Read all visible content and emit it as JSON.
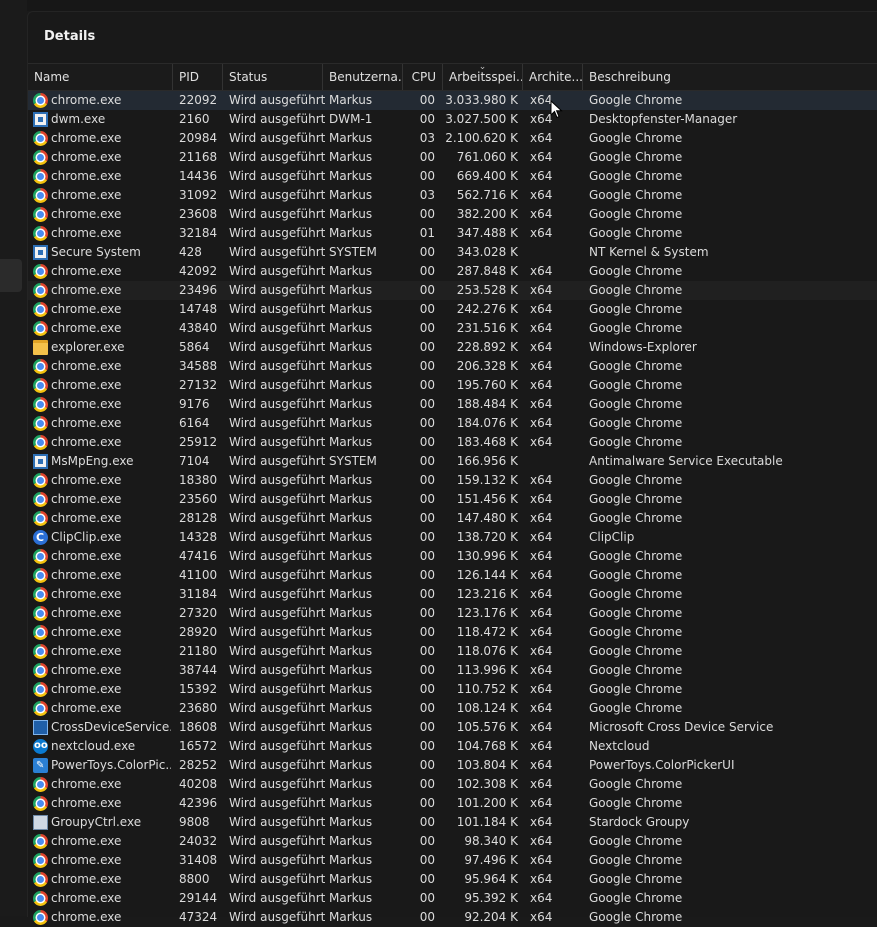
{
  "panel": {
    "title": "Details"
  },
  "columns": {
    "name": "Name",
    "pid": "PID",
    "status": "Status",
    "user": "Benutzerna...",
    "cpu": "CPU",
    "mem": "Arbeitsspei...",
    "arch": "Archite...",
    "desc": "Beschreibung"
  },
  "rows": [
    {
      "name": "chrome.exe",
      "icon": "chrome-icon",
      "pid": "22092",
      "status": "Wird ausgeführt",
      "user": "Markus",
      "cpu": "00",
      "mem": "3.033.980 K",
      "arch": "x64",
      "desc": "Google Chrome"
    },
    {
      "name": "dwm.exe",
      "icon": "system-app-icon",
      "pid": "2160",
      "status": "Wird ausgeführt",
      "user": "DWM-1",
      "cpu": "00",
      "mem": "3.027.500 K",
      "arch": "x64",
      "desc": "Desktopfenster-Manager"
    },
    {
      "name": "chrome.exe",
      "icon": "chrome-icon",
      "pid": "20984",
      "status": "Wird ausgeführt",
      "user": "Markus",
      "cpu": "03",
      "mem": "2.100.620 K",
      "arch": "x64",
      "desc": "Google Chrome"
    },
    {
      "name": "chrome.exe",
      "icon": "chrome-icon",
      "pid": "21168",
      "status": "Wird ausgeführt",
      "user": "Markus",
      "cpu": "00",
      "mem": "761.060 K",
      "arch": "x64",
      "desc": "Google Chrome"
    },
    {
      "name": "chrome.exe",
      "icon": "chrome-icon",
      "pid": "14436",
      "status": "Wird ausgeführt",
      "user": "Markus",
      "cpu": "00",
      "mem": "669.400 K",
      "arch": "x64",
      "desc": "Google Chrome"
    },
    {
      "name": "chrome.exe",
      "icon": "chrome-icon",
      "pid": "31092",
      "status": "Wird ausgeführt",
      "user": "Markus",
      "cpu": "03",
      "mem": "562.716 K",
      "arch": "x64",
      "desc": "Google Chrome"
    },
    {
      "name": "chrome.exe",
      "icon": "chrome-icon",
      "pid": "23608",
      "status": "Wird ausgeführt",
      "user": "Markus",
      "cpu": "00",
      "mem": "382.200 K",
      "arch": "x64",
      "desc": "Google Chrome"
    },
    {
      "name": "chrome.exe",
      "icon": "chrome-icon",
      "pid": "32184",
      "status": "Wird ausgeführt",
      "user": "Markus",
      "cpu": "01",
      "mem": "347.488 K",
      "arch": "x64",
      "desc": "Google Chrome"
    },
    {
      "name": "Secure System",
      "icon": "system-app-icon",
      "pid": "428",
      "status": "Wird ausgeführt",
      "user": "SYSTEM",
      "cpu": "00",
      "mem": "343.028 K",
      "arch": "",
      "desc": "NT Kernel & System"
    },
    {
      "name": "chrome.exe",
      "icon": "chrome-icon",
      "pid": "42092",
      "status": "Wird ausgeführt",
      "user": "Markus",
      "cpu": "00",
      "mem": "287.848 K",
      "arch": "x64",
      "desc": "Google Chrome"
    },
    {
      "name": "chrome.exe",
      "icon": "chrome-icon",
      "pid": "23496",
      "status": "Wird ausgeführt",
      "user": "Markus",
      "cpu": "00",
      "mem": "253.528 K",
      "arch": "x64",
      "desc": "Google Chrome"
    },
    {
      "name": "chrome.exe",
      "icon": "chrome-icon",
      "pid": "14748",
      "status": "Wird ausgeführt",
      "user": "Markus",
      "cpu": "00",
      "mem": "242.276 K",
      "arch": "x64",
      "desc": "Google Chrome"
    },
    {
      "name": "chrome.exe",
      "icon": "chrome-icon",
      "pid": "43840",
      "status": "Wird ausgeführt",
      "user": "Markus",
      "cpu": "00",
      "mem": "231.516 K",
      "arch": "x64",
      "desc": "Google Chrome"
    },
    {
      "name": "explorer.exe",
      "icon": "folder-icon",
      "pid": "5864",
      "status": "Wird ausgeführt",
      "user": "Markus",
      "cpu": "00",
      "mem": "228.892 K",
      "arch": "x64",
      "desc": "Windows-Explorer"
    },
    {
      "name": "chrome.exe",
      "icon": "chrome-icon",
      "pid": "34588",
      "status": "Wird ausgeführt",
      "user": "Markus",
      "cpu": "00",
      "mem": "206.328 K",
      "arch": "x64",
      "desc": "Google Chrome"
    },
    {
      "name": "chrome.exe",
      "icon": "chrome-icon",
      "pid": "27132",
      "status": "Wird ausgeführt",
      "user": "Markus",
      "cpu": "00",
      "mem": "195.760 K",
      "arch": "x64",
      "desc": "Google Chrome"
    },
    {
      "name": "chrome.exe",
      "icon": "chrome-icon",
      "pid": "9176",
      "status": "Wird ausgeführt",
      "user": "Markus",
      "cpu": "00",
      "mem": "188.484 K",
      "arch": "x64",
      "desc": "Google Chrome"
    },
    {
      "name": "chrome.exe",
      "icon": "chrome-icon",
      "pid": "6164",
      "status": "Wird ausgeführt",
      "user": "Markus",
      "cpu": "00",
      "mem": "184.076 K",
      "arch": "x64",
      "desc": "Google Chrome"
    },
    {
      "name": "chrome.exe",
      "icon": "chrome-icon",
      "pid": "25912",
      "status": "Wird ausgeführt",
      "user": "Markus",
      "cpu": "00",
      "mem": "183.468 K",
      "arch": "x64",
      "desc": "Google Chrome"
    },
    {
      "name": "MsMpEng.exe",
      "icon": "system-app-icon",
      "pid": "7104",
      "status": "Wird ausgeführt",
      "user": "SYSTEM",
      "cpu": "00",
      "mem": "166.956 K",
      "arch": "",
      "desc": "Antimalware Service Executable"
    },
    {
      "name": "chrome.exe",
      "icon": "chrome-icon",
      "pid": "18380",
      "status": "Wird ausgeführt",
      "user": "Markus",
      "cpu": "00",
      "mem": "159.132 K",
      "arch": "x64",
      "desc": "Google Chrome"
    },
    {
      "name": "chrome.exe",
      "icon": "chrome-icon",
      "pid": "23560",
      "status": "Wird ausgeführt",
      "user": "Markus",
      "cpu": "00",
      "mem": "151.456 K",
      "arch": "x64",
      "desc": "Google Chrome"
    },
    {
      "name": "chrome.exe",
      "icon": "chrome-icon",
      "pid": "28128",
      "status": "Wird ausgeführt",
      "user": "Markus",
      "cpu": "00",
      "mem": "147.480 K",
      "arch": "x64",
      "desc": "Google Chrome"
    },
    {
      "name": "ClipClip.exe",
      "icon": "clipclip-icon",
      "pid": "14328",
      "status": "Wird ausgeführt",
      "user": "Markus",
      "cpu": "00",
      "mem": "138.720 K",
      "arch": "x64",
      "desc": "ClipClip"
    },
    {
      "name": "chrome.exe",
      "icon": "chrome-icon",
      "pid": "47416",
      "status": "Wird ausgeführt",
      "user": "Markus",
      "cpu": "00",
      "mem": "130.996 K",
      "arch": "x64",
      "desc": "Google Chrome"
    },
    {
      "name": "chrome.exe",
      "icon": "chrome-icon",
      "pid": "41100",
      "status": "Wird ausgeführt",
      "user": "Markus",
      "cpu": "00",
      "mem": "126.144 K",
      "arch": "x64",
      "desc": "Google Chrome"
    },
    {
      "name": "chrome.exe",
      "icon": "chrome-icon",
      "pid": "31184",
      "status": "Wird ausgeführt",
      "user": "Markus",
      "cpu": "00",
      "mem": "123.216 K",
      "arch": "x64",
      "desc": "Google Chrome"
    },
    {
      "name": "chrome.exe",
      "icon": "chrome-icon",
      "pid": "27320",
      "status": "Wird ausgeführt",
      "user": "Markus",
      "cpu": "00",
      "mem": "123.176 K",
      "arch": "x64",
      "desc": "Google Chrome"
    },
    {
      "name": "chrome.exe",
      "icon": "chrome-icon",
      "pid": "28920",
      "status": "Wird ausgeführt",
      "user": "Markus",
      "cpu": "00",
      "mem": "118.472 K",
      "arch": "x64",
      "desc": "Google Chrome"
    },
    {
      "name": "chrome.exe",
      "icon": "chrome-icon",
      "pid": "21180",
      "status": "Wird ausgeführt",
      "user": "Markus",
      "cpu": "00",
      "mem": "118.076 K",
      "arch": "x64",
      "desc": "Google Chrome"
    },
    {
      "name": "chrome.exe",
      "icon": "chrome-icon",
      "pid": "38744",
      "status": "Wird ausgeführt",
      "user": "Markus",
      "cpu": "00",
      "mem": "113.996 K",
      "arch": "x64",
      "desc": "Google Chrome"
    },
    {
      "name": "chrome.exe",
      "icon": "chrome-icon",
      "pid": "15392",
      "status": "Wird ausgeführt",
      "user": "Markus",
      "cpu": "00",
      "mem": "110.752 K",
      "arch": "x64",
      "desc": "Google Chrome"
    },
    {
      "name": "chrome.exe",
      "icon": "chrome-icon",
      "pid": "23680",
      "status": "Wird ausgeführt",
      "user": "Markus",
      "cpu": "00",
      "mem": "108.124 K",
      "arch": "x64",
      "desc": "Google Chrome"
    },
    {
      "name": "CrossDeviceService.e...",
      "icon": "cross-device-icon",
      "pid": "18608",
      "status": "Wird ausgeführt",
      "user": "Markus",
      "cpu": "00",
      "mem": "105.576 K",
      "arch": "x64",
      "desc": "Microsoft Cross Device Service"
    },
    {
      "name": "nextcloud.exe",
      "icon": "nextcloud-icon",
      "pid": "16572",
      "status": "Wird ausgeführt",
      "user": "Markus",
      "cpu": "00",
      "mem": "104.768 K",
      "arch": "x64",
      "desc": "Nextcloud"
    },
    {
      "name": "PowerToys.ColorPic...",
      "icon": "color-picker-icon",
      "pid": "28252",
      "status": "Wird ausgeführt",
      "user": "Markus",
      "cpu": "00",
      "mem": "103.804 K",
      "arch": "x64",
      "desc": "PowerToys.ColorPickerUI"
    },
    {
      "name": "chrome.exe",
      "icon": "chrome-icon",
      "pid": "40208",
      "status": "Wird ausgeführt",
      "user": "Markus",
      "cpu": "00",
      "mem": "102.308 K",
      "arch": "x64",
      "desc": "Google Chrome"
    },
    {
      "name": "chrome.exe",
      "icon": "chrome-icon",
      "pid": "42396",
      "status": "Wird ausgeführt",
      "user": "Markus",
      "cpu": "00",
      "mem": "101.200 K",
      "arch": "x64",
      "desc": "Google Chrome"
    },
    {
      "name": "GroupyCtrl.exe",
      "icon": "groupy-icon",
      "pid": "9808",
      "status": "Wird ausgeführt",
      "user": "Markus",
      "cpu": "00",
      "mem": "101.184 K",
      "arch": "x64",
      "desc": "Stardock Groupy"
    },
    {
      "name": "chrome.exe",
      "icon": "chrome-icon",
      "pid": "24032",
      "status": "Wird ausgeführt",
      "user": "Markus",
      "cpu": "00",
      "mem": "98.340 K",
      "arch": "x64",
      "desc": "Google Chrome"
    },
    {
      "name": "chrome.exe",
      "icon": "chrome-icon",
      "pid": "31408",
      "status": "Wird ausgeführt",
      "user": "Markus",
      "cpu": "00",
      "mem": "97.496 K",
      "arch": "x64",
      "desc": "Google Chrome"
    },
    {
      "name": "chrome.exe",
      "icon": "chrome-icon",
      "pid": "8800",
      "status": "Wird ausgeführt",
      "user": "Markus",
      "cpu": "00",
      "mem": "95.964 K",
      "arch": "x64",
      "desc": "Google Chrome"
    },
    {
      "name": "chrome.exe",
      "icon": "chrome-icon",
      "pid": "29144",
      "status": "Wird ausgeführt",
      "user": "Markus",
      "cpu": "00",
      "mem": "95.392 K",
      "arch": "x64",
      "desc": "Google Chrome"
    },
    {
      "name": "chrome.exe",
      "icon": "chrome-icon",
      "pid": "47324",
      "status": "Wird ausgeführt",
      "user": "Markus",
      "cpu": "00",
      "mem": "92.204 K",
      "arch": "x64",
      "desc": "Google Chrome"
    }
  ],
  "selected_row": 0,
  "hover_row": 10,
  "sort": {
    "column": "mem",
    "direction": "descending"
  },
  "colors": {
    "background": "#191919",
    "selected": "#232a33",
    "text": "#dcdcdc"
  }
}
